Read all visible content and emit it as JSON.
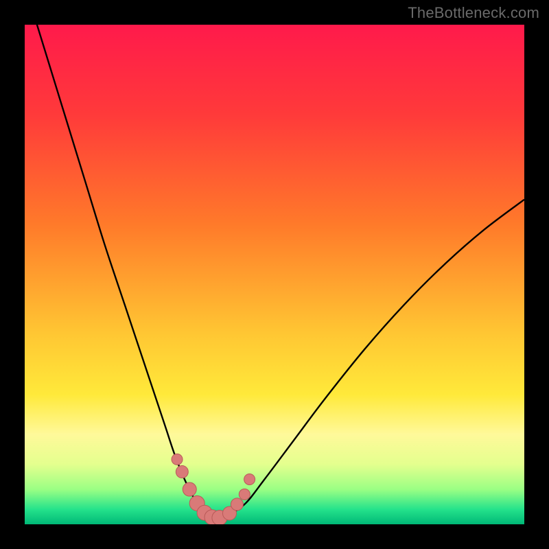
{
  "watermark": "TheBottleneck.com",
  "colors": {
    "frame": "#000000",
    "gradient_stops": [
      {
        "offset": 0.0,
        "color": "#ff1a4b"
      },
      {
        "offset": 0.18,
        "color": "#ff3a3a"
      },
      {
        "offset": 0.4,
        "color": "#ff7a2a"
      },
      {
        "offset": 0.62,
        "color": "#ffc733"
      },
      {
        "offset": 0.74,
        "color": "#ffe93a"
      },
      {
        "offset": 0.82,
        "color": "#fff99a"
      },
      {
        "offset": 0.88,
        "color": "#e4ff8e"
      },
      {
        "offset": 0.93,
        "color": "#9bff84"
      },
      {
        "offset": 0.97,
        "color": "#25e38b"
      },
      {
        "offset": 1.0,
        "color": "#00b877"
      }
    ],
    "curve": "#000000",
    "marker_fill": "#d97a78",
    "marker_stroke": "#b85a58"
  },
  "chart_data": {
    "type": "line",
    "title": "",
    "xlabel": "",
    "ylabel": "",
    "xlim": [
      0,
      100
    ],
    "ylim": [
      0,
      100
    ],
    "grid": false,
    "legend": false,
    "series": [
      {
        "name": "bottleneck-curve",
        "x": [
          0,
          4,
          8,
          12,
          16,
          20,
          24,
          28,
          30,
          32,
          34,
          36,
          38,
          40,
          44,
          48,
          54,
          60,
          68,
          76,
          84,
          92,
          100
        ],
        "y": [
          108,
          95,
          82,
          69,
          56,
          44,
          32,
          20,
          14,
          9,
          5,
          2,
          1,
          1.5,
          4,
          9,
          17,
          25,
          35,
          44,
          52,
          59,
          65
        ]
      }
    ],
    "markers": {
      "name": "highlighted-points",
      "x": [
        30.5,
        31.5,
        33,
        34.5,
        36,
        37.5,
        39,
        41,
        42.5,
        44,
        45
      ],
      "y": [
        13,
        10.5,
        7,
        4.2,
        2.3,
        1.4,
        1.3,
        2.2,
        4.0,
        6.0,
        9.0
      ],
      "r": [
        8,
        9,
        10,
        11,
        11,
        11,
        11,
        10,
        9,
        8,
        8
      ]
    }
  }
}
